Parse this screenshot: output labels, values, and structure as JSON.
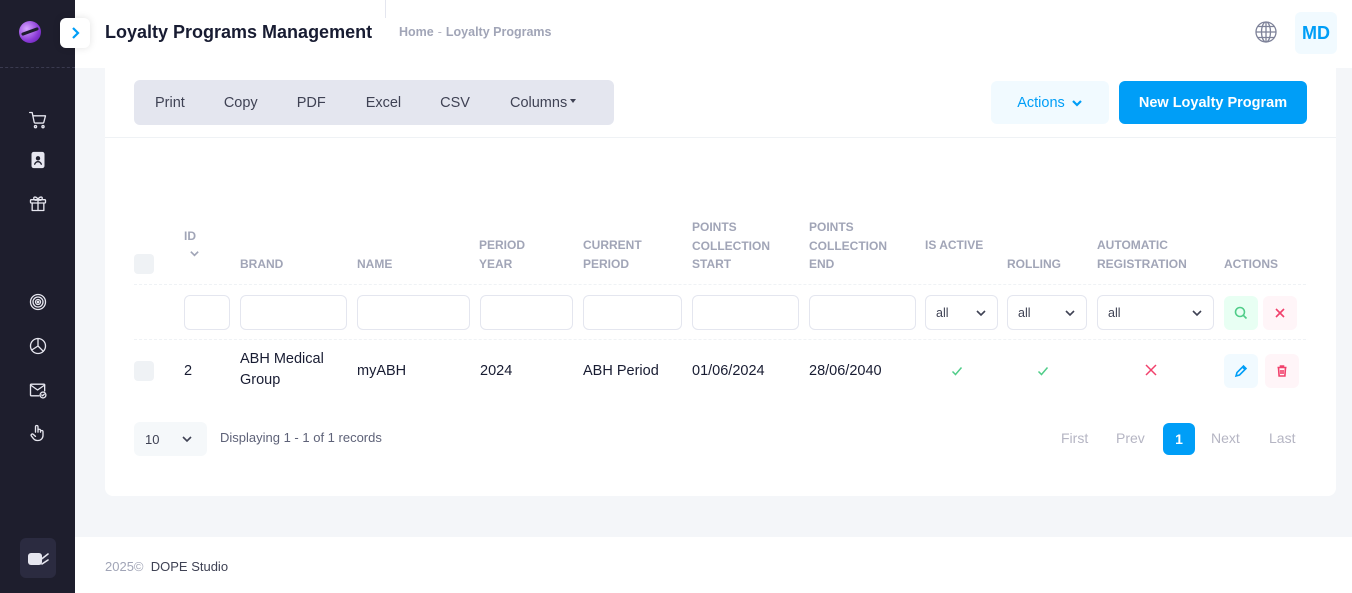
{
  "header": {
    "title": "Loyalty Programs Management",
    "breadcrumb": {
      "home": "Home",
      "separator": "-",
      "current": "Loyalty Programs"
    },
    "avatar_initials": "MD"
  },
  "sidebar": {
    "icons": [
      "cart-icon",
      "id-badge-icon",
      "gift-icon",
      "target-icon",
      "pie-chart-icon",
      "mail-check-icon",
      "hand-pointer-icon"
    ]
  },
  "toolbar": {
    "export_buttons": [
      "Print",
      "Copy",
      "PDF",
      "Excel",
      "CSV",
      "Columns"
    ],
    "actions_label": "Actions",
    "new_label": "New Loyalty Program"
  },
  "table": {
    "columns": [
      {
        "key": "id",
        "label": "ID"
      },
      {
        "key": "brand",
        "label": "BRAND"
      },
      {
        "key": "name",
        "label": "NAME"
      },
      {
        "key": "period_year",
        "label": "PERIOD YEAR"
      },
      {
        "key": "current_period",
        "label": "CURRENT PERIOD"
      },
      {
        "key": "points_start",
        "label": "POINTS COLLECTION START"
      },
      {
        "key": "points_end",
        "label": "POINTS COLLECTION END"
      },
      {
        "key": "is_active",
        "label": "IS ACTIVE"
      },
      {
        "key": "rolling",
        "label": "ROLLING"
      },
      {
        "key": "auto_reg",
        "label": "AUTOMATIC REGISTRATION"
      },
      {
        "key": "actions",
        "label": "ACTIONS"
      }
    ],
    "filters": {
      "is_active": "all",
      "rolling": "all",
      "auto_reg": "all"
    },
    "rows": [
      {
        "id": "2",
        "brand_line1": "ABH Medical",
        "brand_line2": "Group",
        "name": "myABH",
        "period_year": "2024",
        "current_period": "ABH Period",
        "points_start": "01/06/2024",
        "points_end": "28/06/2040",
        "is_active": true,
        "rolling": true,
        "auto_reg": false
      }
    ]
  },
  "pagination": {
    "per_page": "10",
    "records_text": "Displaying 1 - 1 of 1 records",
    "first": "First",
    "prev": "Prev",
    "current": "1",
    "next": "Next",
    "last": "Last"
  },
  "footer": {
    "year": "2025©",
    "company": "DOPE Studio"
  },
  "colors": {
    "primary": "#009ef7",
    "success": "#50cd89",
    "danger": "#f1416c",
    "sidebar": "#1e1e2d"
  }
}
